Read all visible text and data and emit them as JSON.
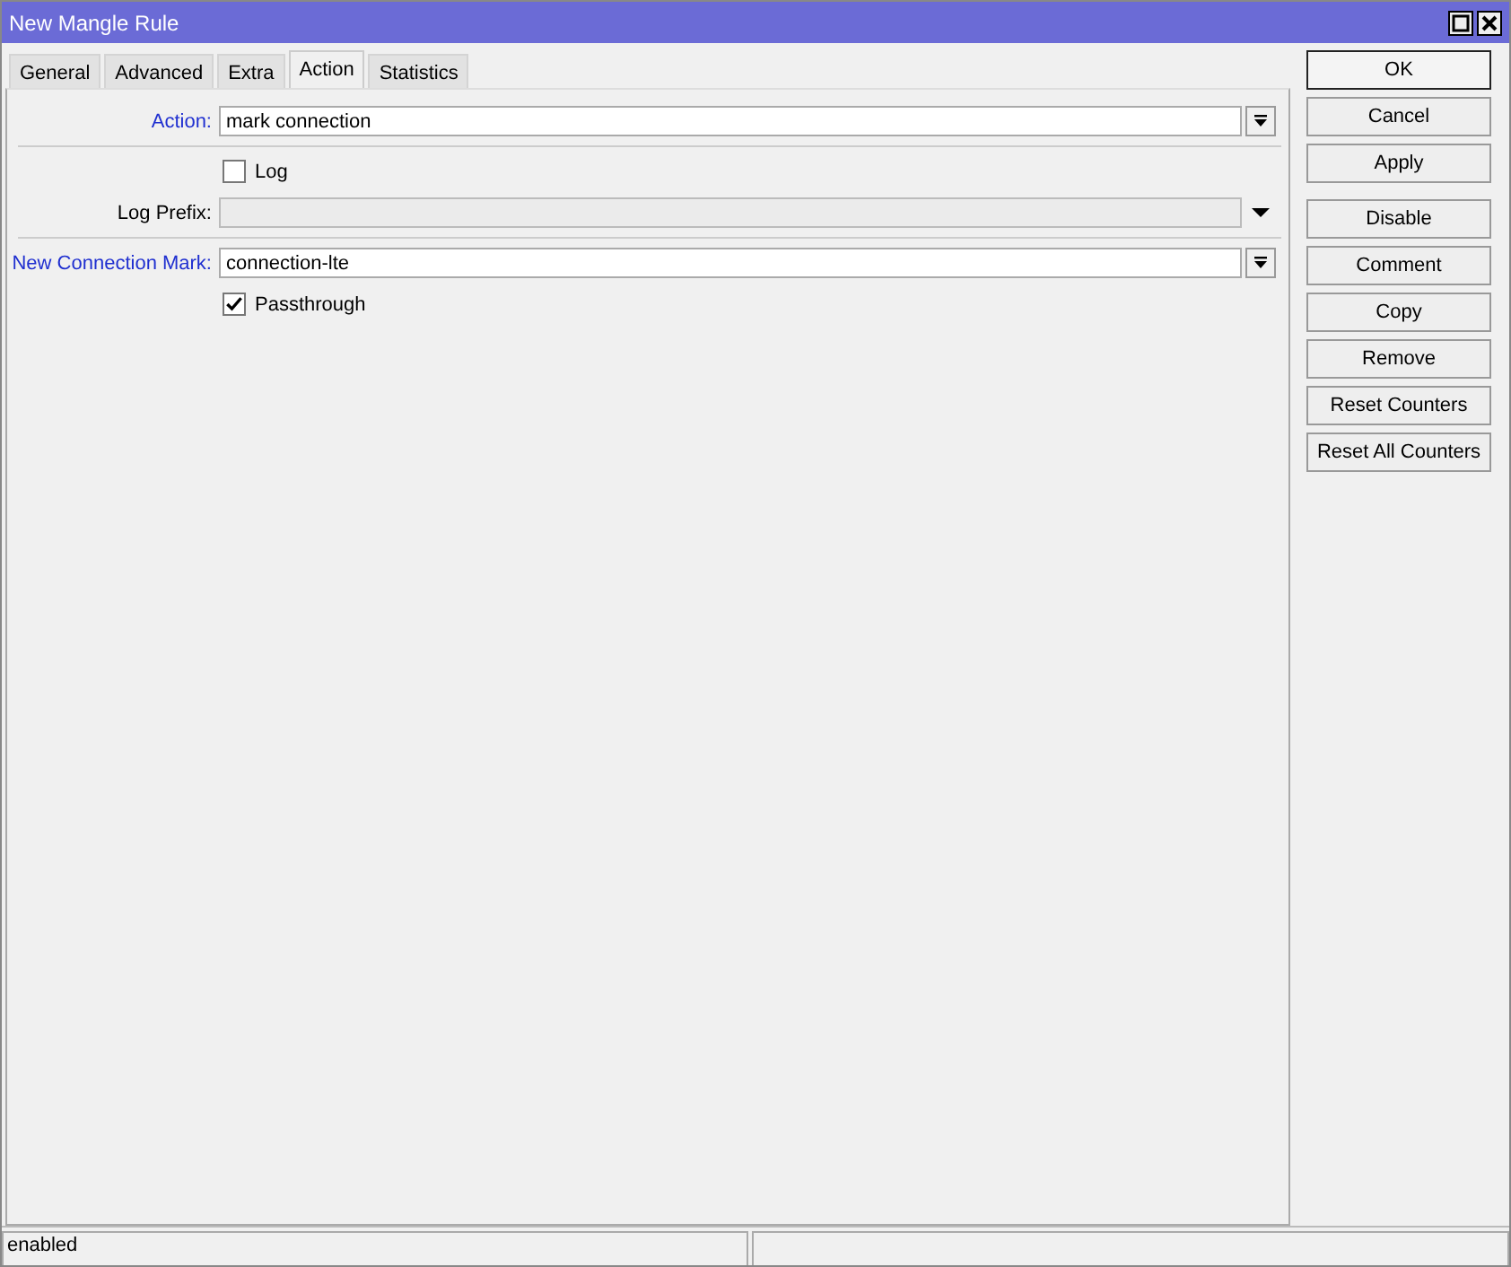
{
  "window": {
    "title": "New Mangle Rule"
  },
  "tabs": [
    {
      "label": "General",
      "selected": false
    },
    {
      "label": "Advanced",
      "selected": false
    },
    {
      "label": "Extra",
      "selected": false
    },
    {
      "label": "Action",
      "selected": true
    },
    {
      "label": "Statistics",
      "selected": false
    }
  ],
  "groups": [
    [
      {
        "kind": "select",
        "label": "Action:",
        "highlighted": true,
        "value": "mark connection",
        "disabled": false
      }
    ],
    [
      {
        "kind": "checkbox",
        "label": "Log",
        "checked": false
      },
      {
        "kind": "select",
        "label": "Log Prefix:",
        "highlighted": false,
        "disabled": true
      }
    ],
    [
      {
        "kind": "select",
        "label": "New Connection Mark:",
        "highlighted": true,
        "value": "connection-lte",
        "disabled": false
      },
      {
        "kind": "checkbox",
        "label": "Passthrough",
        "checked": true
      }
    ]
  ],
  "button_groups": [
    [
      {
        "label": "OK",
        "default": true
      },
      {
        "label": "Cancel",
        "default": false
      },
      {
        "label": "Apply",
        "default": false
      }
    ],
    [
      {
        "label": "Disable",
        "default": false
      },
      {
        "label": "Comment",
        "default": false
      },
      {
        "label": "Copy",
        "default": false
      },
      {
        "label": "Remove",
        "default": false
      },
      {
        "label": "Reset Counters",
        "default": false
      },
      {
        "label": "Reset All Counters",
        "default": false
      }
    ]
  ],
  "status_bar": [
    "enabled"
  ]
}
